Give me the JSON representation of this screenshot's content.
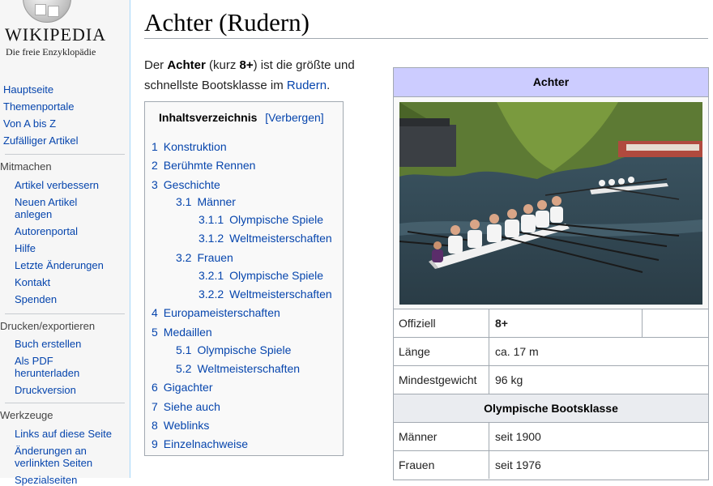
{
  "logo": {
    "wordmark": "WIKIPEDIA",
    "tagline": "Die freie Enzyklopädie"
  },
  "nav": {
    "main": [
      "Hauptseite",
      "Themenportale",
      "Von A bis Z",
      "Zufälliger Artikel"
    ],
    "mitmachen": {
      "heading": "Mitmachen",
      "items": [
        "Artikel verbessern",
        "Neuen Artikel anlegen",
        "Autorenportal",
        "Hilfe",
        "Letzte Änderungen",
        "Kontakt",
        "Spenden"
      ]
    },
    "drucken": {
      "heading": "Drucken/exportieren",
      "items": [
        "Buch erstellen",
        "Als PDF herunterladen",
        "Druckversion"
      ]
    },
    "werkzeuge": {
      "heading": "Werkzeuge",
      "items": [
        "Links auf diese Seite",
        "Änderungen an verlinkten Seiten",
        "Spezialseiten"
      ]
    }
  },
  "article": {
    "title": "Achter (Rudern)",
    "intro": {
      "t1": "Der ",
      "b1": "Achter",
      "t2": " (kurz ",
      "b2": "8+",
      "t3": ") ist die größte und schnellste Bootsklasse im ",
      "link": "Rudern",
      "t4": "."
    }
  },
  "toc": {
    "title": "Inhaltsverzeichnis",
    "toggle": "[Verbergen]",
    "items": [
      {
        "num": "1",
        "text": "Konstruktion"
      },
      {
        "num": "2",
        "text": "Berühmte Rennen"
      },
      {
        "num": "3",
        "text": "Geschichte"
      },
      {
        "num": "3.1",
        "text": "Männer"
      },
      {
        "num": "3.1.1",
        "text": "Olympische Spiele"
      },
      {
        "num": "3.1.2",
        "text": "Weltmeisterschaften"
      },
      {
        "num": "3.2",
        "text": "Frauen"
      },
      {
        "num": "3.2.1",
        "text": "Olympische Spiele"
      },
      {
        "num": "3.2.2",
        "text": "Weltmeisterschaften"
      },
      {
        "num": "4",
        "text": "Europameisterschaften"
      },
      {
        "num": "5",
        "text": "Medaillen"
      },
      {
        "num": "5.1",
        "text": "Olympische Spiele"
      },
      {
        "num": "5.2",
        "text": "Weltmeisterschaften"
      },
      {
        "num": "6",
        "text": "Gigachter"
      },
      {
        "num": "7",
        "text": "Siehe auch"
      },
      {
        "num": "8",
        "text": "Weblinks"
      },
      {
        "num": "9",
        "text": "Einzelnachweise"
      }
    ]
  },
  "infobox": {
    "title": "Achter",
    "rows": [
      {
        "key": "Offiziell",
        "value": "8+"
      },
      {
        "key": "Länge",
        "value": "ca. 17 m"
      },
      {
        "key": "Mindestgewicht",
        "value": "96 kg"
      }
    ],
    "subheader": "Olympische Bootsklasse",
    "rows2": [
      {
        "key": "Männer",
        "value": "seit 1900"
      },
      {
        "key": "Frauen",
        "value": "seit 1976"
      }
    ]
  },
  "colors": {
    "link": "#0645ad",
    "infobox_header": "#ccccff",
    "sidebar_bg": "#f6f6f6"
  }
}
